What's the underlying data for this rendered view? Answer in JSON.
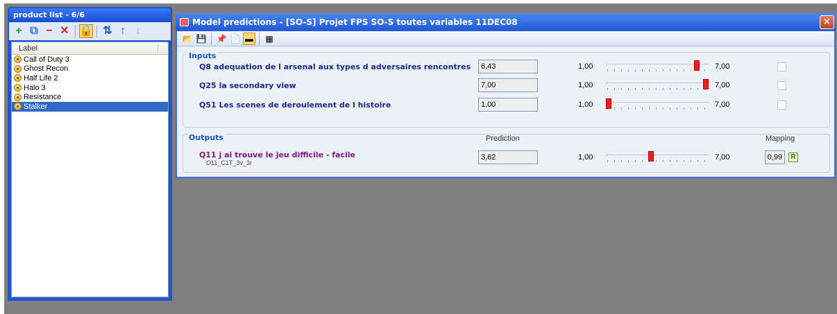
{
  "product_list": {
    "title": "product list - 6/6",
    "toolbar": [
      {
        "name": "add-icon",
        "glyph": "+",
        "color": "#2e9e2e"
      },
      {
        "name": "copy-icon",
        "glyph": "⧉",
        "color": "#3d78d8"
      },
      {
        "name": "remove-icon",
        "glyph": "−",
        "color": "#d22a2a"
      },
      {
        "name": "delete-icon",
        "glyph": "✕",
        "color": "#d22a2a"
      },
      {
        "name": "lock-toggle-icon",
        "glyph": "🔒",
        "color": "#c98a10",
        "active": true
      },
      {
        "name": "sort-az-icon",
        "glyph": "⇅",
        "color": "#2555c0"
      },
      {
        "name": "move-up-icon",
        "glyph": "↑",
        "color": "#2555c0"
      },
      {
        "name": "move-down-icon",
        "glyph": "↓",
        "color": "#8fa9d6"
      }
    ],
    "column_header": "Label",
    "items": [
      "Call of Duty 3",
      "Ghost Recon",
      "Half Life 2",
      "Halo 3",
      "Resistance",
      "Stalker"
    ],
    "selected_index": 5
  },
  "model_predictions": {
    "title": "Model predictions - [SO-S] Projet FPS SO-S toutes variables 11DEC08",
    "close_glyph": "✕",
    "toolbar": [
      {
        "name": "open-folder-icon",
        "glyph": "📂"
      },
      {
        "name": "save-icon",
        "glyph": "💾"
      },
      {
        "name": "pin-icon",
        "glyph": "📌"
      },
      {
        "name": "document-icon",
        "glyph": "📄"
      },
      {
        "name": "minus-panel-icon",
        "glyph": "▬",
        "active": true
      },
      {
        "name": "grid-icon",
        "glyph": "▦"
      }
    ],
    "inputs": {
      "title": "Inputs",
      "rows": [
        {
          "label": "Q8 adequation de l arsenal aux types d adversaires rencontres",
          "value": "6,43",
          "min": "1,00",
          "max": "7,00",
          "level": 6.43
        },
        {
          "label": "Q25 la secondary view",
          "value": "7,00",
          "min": "1,00",
          "max": "7,00",
          "level": 7.0
        },
        {
          "label": "Q51 Les scenes de deroulement de l histoire",
          "value": "1,00",
          "min": "1,00",
          "max": "7,00",
          "level": 1.0
        }
      ]
    },
    "outputs": {
      "title": "Outputs",
      "prediction_header": "Prediction",
      "mapping_header": "Mapping",
      "row": {
        "label": "Q11 j ai trouve le jeu difficile - facile",
        "sublabel": "O11_C1T_3v_3r",
        "value": "3,62",
        "min": "1,00",
        "max": "7,00",
        "level": 3.62,
        "mapping": "0,99",
        "mapping_icon": "R"
      }
    }
  }
}
